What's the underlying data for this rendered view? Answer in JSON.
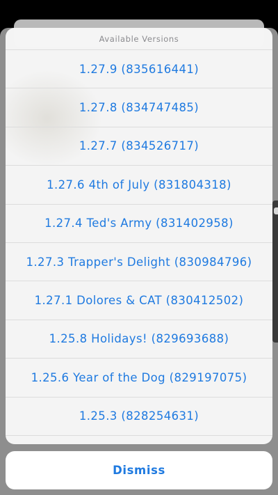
{
  "sheet": {
    "title": "Available Versions",
    "versions": [
      "1.27.9 (835616441)",
      "1.27.8 (834747485)",
      "1.27.7 (834526717)",
      "1.27.6 4th of July (831804318)",
      "1.27.4 Ted's Army (831402958)",
      "1.27.3 Trapper's Delight (830984796)",
      "1.27.1 Dolores & CAT (830412502)",
      "1.25.8 Holidays! (829693688)",
      "1.25.6 Year of the Dog (829197075)",
      "1.25.3 (828254631)"
    ]
  },
  "dismiss_label": "Dismiss",
  "colors": {
    "accent": "#1f7ae0",
    "sheet_background": "#f8f8f8",
    "separator": "#dcdcdc",
    "title_text": "#8a8a8e"
  }
}
